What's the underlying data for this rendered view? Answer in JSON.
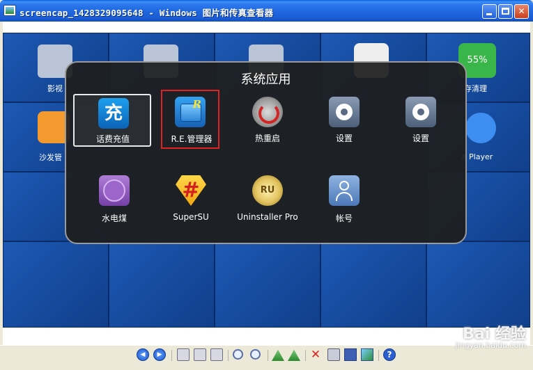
{
  "window": {
    "title": "screencap_1428329095648 - Windows 图片和传真查看器",
    "min_label": "",
    "max_label": "",
    "close_label": "✕"
  },
  "background_labels": [
    {
      "text": "影视"
    },
    {
      "text": "存清理"
    },
    {
      "text": "沙发管"
    },
    {
      "text": "X Player"
    }
  ],
  "popup": {
    "title": "系统应用",
    "apps": [
      {
        "label": "话费充值",
        "icon": "recharge-icon",
        "glyph": "充",
        "selected": true
      },
      {
        "label": "R.E.管理器",
        "icon": "re-manager-icon",
        "highlighted": true
      },
      {
        "label": "热重启",
        "icon": "reboot-icon"
      },
      {
        "label": "设置",
        "icon": "settings-icon"
      },
      {
        "label": "设置",
        "icon": "settings-icon"
      },
      {
        "label": "水电煤",
        "icon": "utility-icon"
      },
      {
        "label": "SuperSU",
        "icon": "supersu-icon"
      },
      {
        "label": "Uninstaller Pro",
        "icon": "uninstaller-icon",
        "glyph": "RU"
      },
      {
        "label": "帐号",
        "icon": "account-icon"
      }
    ]
  },
  "background_tile_icons": {
    "storage_percent": "55%"
  },
  "toolbar": {
    "prev_label": "◀",
    "next_label": "▶",
    "delete_label": "✕",
    "help_label": "?"
  },
  "watermark": {
    "main": "Bai 经验",
    "sub": "jingyan.baidu.com"
  },
  "colors": {
    "titlebar": "#1f66dd",
    "popup_bg": "#1e1e1e",
    "highlight_red": "#e02222",
    "tile_blue": "#164b9e"
  }
}
